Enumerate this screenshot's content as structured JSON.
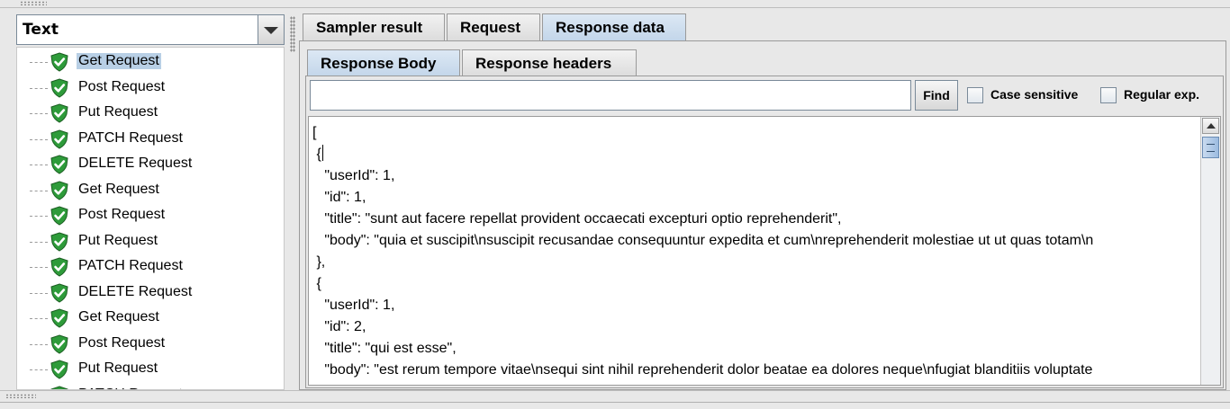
{
  "viewer": {
    "renderer_selected": "Text",
    "tree_items": [
      {
        "label": "Get Request",
        "icon": "shield-check-icon",
        "selected": true
      },
      {
        "label": "Post Request",
        "icon": "shield-check-icon"
      },
      {
        "label": "Put Request",
        "icon": "shield-check-icon"
      },
      {
        "label": "PATCH Request",
        "icon": "shield-check-icon"
      },
      {
        "label": "DELETE Request",
        "icon": "shield-check-icon"
      },
      {
        "label": "Get Request",
        "icon": "shield-check-icon"
      },
      {
        "label": "Post Request",
        "icon": "shield-check-icon"
      },
      {
        "label": "Put Request",
        "icon": "shield-check-icon"
      },
      {
        "label": "PATCH Request",
        "icon": "shield-check-icon"
      },
      {
        "label": "DELETE Request",
        "icon": "shield-check-icon"
      },
      {
        "label": "Get Request",
        "icon": "shield-check-icon"
      },
      {
        "label": "Post Request",
        "icon": "shield-check-icon"
      },
      {
        "label": "Put Request",
        "icon": "shield-check-icon"
      },
      {
        "label": "PATCH Request",
        "icon": "shield-check-icon"
      }
    ]
  },
  "tabs": [
    "Sampler result",
    "Request",
    "Response data"
  ],
  "active_tab": "Response data",
  "subtabs": [
    "Response Body",
    "Response headers"
  ],
  "active_subtab": "Response Body",
  "search": {
    "value": "",
    "find_label": "Find",
    "case_sensitive_label": "Case sensitive",
    "regex_label": "Regular exp."
  },
  "response_lines": [
    "[",
    " {",
    "   \"userId\": 1,",
    "   \"id\": 1,",
    "   \"title\": \"sunt aut facere repellat provident occaecati excepturi optio reprehenderit\",",
    "   \"body\": \"quia et suscipit\\nsuscipit recusandae consequuntur expedita et cum\\nreprehenderit molestiae ut ut quas totam\\n",
    " },",
    " {",
    "   \"userId\": 1,",
    "   \"id\": 2,",
    "   \"title\": \"qui est esse\",",
    "   \"body\": \"est rerum tempore vitae\\nsequi sint nihil reprehenderit dolor beatae ea dolores neque\\nfugiat blanditiis voluptate"
  ],
  "colors": {
    "shield_green": "#2e9b3a",
    "selection": "#b8cfe5",
    "active_tab": "#c3d6ea"
  }
}
